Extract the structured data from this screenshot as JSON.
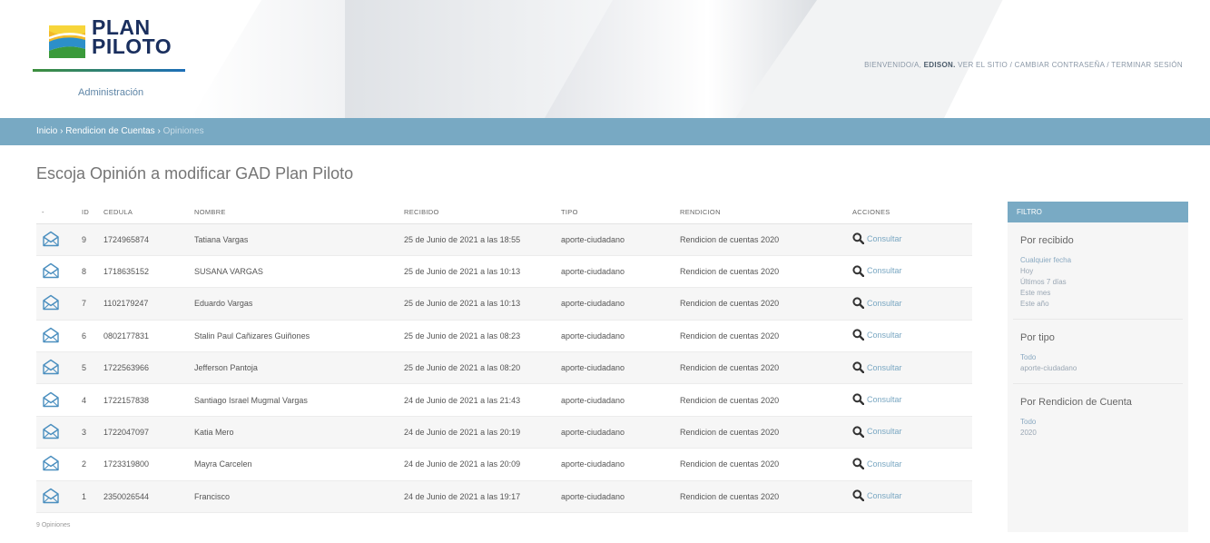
{
  "header": {
    "logo_line1": "PLAN",
    "logo_line2": "PILOTO",
    "admin_label": "Administración",
    "user_links": {
      "welcome": "BIENVENIDO/A,",
      "user": "EDISON.",
      "view_site": "VER EL SITIO",
      "change_password": "CAMBIAR CONTRASEÑA",
      "logout": "TERMINAR SESIÓN"
    }
  },
  "breadcrumb": {
    "home": "Inicio",
    "section": "Rendicion de Cuentas",
    "current": "Opiniones",
    "sep": "›"
  },
  "page_title": "Escoja Opinión a modificar GAD Plan Piloto",
  "table": {
    "headers": [
      "-",
      "ID",
      "CEDULA",
      "NOMBRE",
      "RECIBIDO",
      "TIPO",
      "RENDICION",
      "ACCIONES"
    ],
    "action_label": "Consultar",
    "rows": [
      {
        "id": "9",
        "cedula": "1724965874",
        "nombre": "Tatiana Vargas",
        "recibido": "25 de Junio de 2021 a las 18:55",
        "tipo": "aporte-ciudadano",
        "rendicion": "Rendicion de cuentas 2020"
      },
      {
        "id": "8",
        "cedula": "1718635152",
        "nombre": "SUSANA VARGAS",
        "recibido": "25 de Junio de 2021 a las 10:13",
        "tipo": "aporte-ciudadano",
        "rendicion": "Rendicion de cuentas 2020"
      },
      {
        "id": "7",
        "cedula": "1102179247",
        "nombre": "Eduardo Vargas",
        "recibido": "25 de Junio de 2021 a las 10:13",
        "tipo": "aporte-ciudadano",
        "rendicion": "Rendicion de cuentas 2020"
      },
      {
        "id": "6",
        "cedula": "0802177831",
        "nombre": "Stalin Paul Cañizares Guiñones",
        "recibido": "25 de Junio de 2021 a las 08:23",
        "tipo": "aporte-ciudadano",
        "rendicion": "Rendicion de cuentas 2020"
      },
      {
        "id": "5",
        "cedula": "1722563966",
        "nombre": "Jefferson Pantoja",
        "recibido": "25 de Junio de 2021 a las 08:20",
        "tipo": "aporte-ciudadano",
        "rendicion": "Rendicion de cuentas 2020"
      },
      {
        "id": "4",
        "cedula": "1722157838",
        "nombre": "Santiago Israel Mugmal Vargas",
        "recibido": "24 de Junio de 2021 a las 21:43",
        "tipo": "aporte-ciudadano",
        "rendicion": "Rendicion de cuentas 2020"
      },
      {
        "id": "3",
        "cedula": "1722047097",
        "nombre": "Katia Mero",
        "recibido": "24 de Junio de 2021 a las 20:19",
        "tipo": "aporte-ciudadano",
        "rendicion": "Rendicion de cuentas 2020"
      },
      {
        "id": "2",
        "cedula": "1723319800",
        "nombre": "Mayra Carcelen",
        "recibido": "24 de Junio de 2021 a las 20:09",
        "tipo": "aporte-ciudadano",
        "rendicion": "Rendicion de cuentas 2020"
      },
      {
        "id": "1",
        "cedula": "2350026544",
        "nombre": "Francisco",
        "recibido": "24 de Junio de 2021 a las 19:17",
        "tipo": "aporte-ciudadano",
        "rendicion": "Rendicion de cuentas 2020"
      }
    ]
  },
  "count_label": "9 Opiniones",
  "filter": {
    "title": "FILTRO",
    "groups": [
      {
        "title": "Por recibido",
        "options": [
          "Cualquier fecha",
          "Hoy",
          "Últimos 7 días",
          "Este mes",
          "Este año"
        ]
      },
      {
        "title": "Por tipo",
        "options": [
          "Todo",
          "aporte-ciudadano"
        ]
      },
      {
        "title": "Por Rendicion de Cuenta",
        "options": [
          "Todo",
          "2020"
        ]
      }
    ]
  },
  "colors": {
    "breadcrumb_bar": "#78a9c3",
    "link": "#79a7c2",
    "logo_text": "#1a2f5e"
  },
  "icons": {
    "row_icon": "envelope-open-icon",
    "action_icon": "search-icon"
  }
}
